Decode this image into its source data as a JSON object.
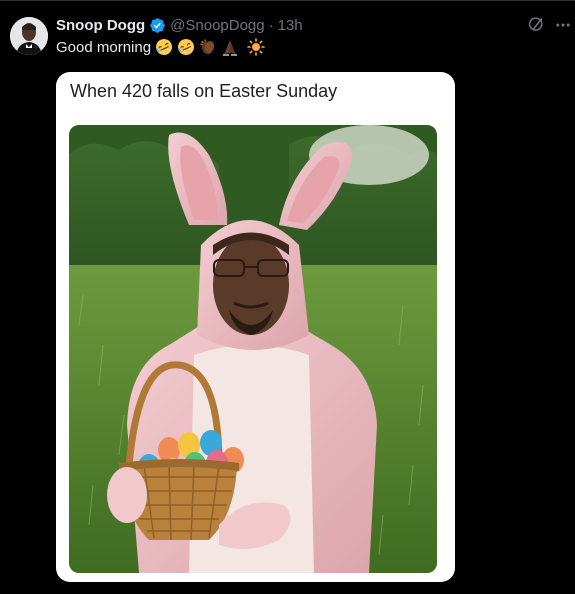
{
  "tweet": {
    "author_name": "Snoop Dogg",
    "handle": "@SnoopDogg",
    "separator": "·",
    "time": "13h",
    "text": "Good morning",
    "emojis": [
      "rolling-on-floor-laughing",
      "rolling-on-floor-laughing",
      "clapping-hands-dark-skin",
      "folded-hands-dark-skin",
      "sun"
    ],
    "verified": true
  },
  "media": {
    "caption": "When 420 falls on Easter Sunday",
    "photo_subject": "man in pink bunny costume holding basket of colored eggs in a grassy field"
  },
  "colors": {
    "background": "#000000",
    "text_primary": "#e7e9ea",
    "text_secondary": "#71767b",
    "verified_blue": "#1d9bf0",
    "card_background": "#ffffff",
    "bunny_pink": "#efbfc4"
  },
  "icons": {
    "verified": "verified-badge-icon",
    "grok": "grok-icon",
    "more": "more-options-icon"
  }
}
